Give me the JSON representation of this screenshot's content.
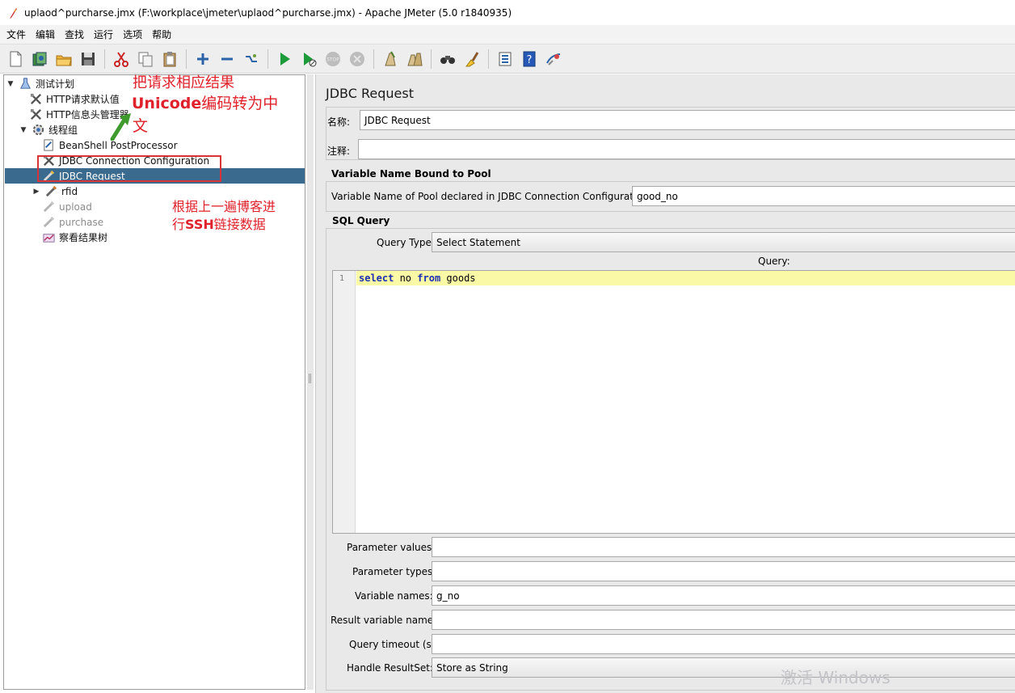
{
  "window": {
    "title": "uplaod^purcharse.jmx (F:\\workplace\\jmeter\\uplaod^purcharse.jmx) - Apache JMeter (5.0 r1840935)"
  },
  "menu": [
    "文件",
    "编辑",
    "查找",
    "运行",
    "选项",
    "帮助"
  ],
  "toolbar": {
    "icons": [
      "new-icon",
      "templates-icon",
      "open-icon",
      "save-icon",
      "cut-icon",
      "copy-icon",
      "paste-icon",
      "expand-icon",
      "collapse-icon",
      "toggle-icon",
      "start-icon",
      "start-no-pause-icon",
      "stop-icon",
      "shutdown-icon",
      "clear-icon",
      "clear-all-icon",
      "search-icon",
      "reset-search-icon",
      "function-helper-icon",
      "help-icon",
      "remote-icon"
    ]
  },
  "tree": [
    {
      "label": "测试计划",
      "icon": "test-plan-icon",
      "expanded": true
    },
    {
      "label": "HTTP请求默认值",
      "icon": "config-icon"
    },
    {
      "label": "HTTP信息头管理器",
      "icon": "config-icon"
    },
    {
      "label": "线程组",
      "icon": "thread-group-icon",
      "expanded": true
    },
    {
      "label": "BeanShell PostProcessor",
      "icon": "postprocessor-icon"
    },
    {
      "label": "JDBC Connection Configuration",
      "icon": "config-icon"
    },
    {
      "label": "JDBC Request",
      "icon": "sampler-icon",
      "selected": true
    },
    {
      "label": "rfid",
      "icon": "sampler-icon",
      "collapsed": true
    },
    {
      "label": "upload",
      "icon": "sampler-icon",
      "disabled": true
    },
    {
      "label": "purchase",
      "icon": "sampler-icon",
      "disabled": true
    },
    {
      "label": "察看结果树",
      "icon": "listener-icon"
    }
  ],
  "annotations": {
    "top_line1": "把请求相应结果",
    "top_line2_bold": "Unicode",
    "top_line2_rest": "编码转为中",
    "top_line3": "文",
    "mid_line1": "根据上一遍博客进",
    "mid_line2_pre": "行",
    "mid_line2_bold": "SSH",
    "mid_line2_rest": "链接数据"
  },
  "panel": {
    "title": "JDBC Request",
    "name_label": "名称:",
    "name_value": "JDBC Request",
    "comment_label": "注释:",
    "comment_value": "",
    "pool_section_title": "Variable Name Bound to Pool",
    "pool_label": "Variable Name of Pool declared in JDBC Connection Configuration:",
    "pool_value": "good_no",
    "sql_section_title": "SQL Query",
    "query_type_label": "Query Type:",
    "query_type_value": "Select Statement",
    "query_label": "Query:",
    "query_line_no": "1",
    "query_kw1": "select",
    "query_mid": " no ",
    "query_kw2": "from",
    "query_end": " goods",
    "parameter_values_label": "Parameter values:",
    "parameter_values_value": "",
    "parameter_types_label": "Parameter types:",
    "parameter_types_value": "",
    "variable_names_label": "Variable names:",
    "variable_names_value": "g_no",
    "result_variable_label": "Result variable name:",
    "result_variable_value": "",
    "query_timeout_label": "Query timeout (s):",
    "query_timeout_value": "",
    "handle_resultset_label": "Handle ResultSet:",
    "handle_resultset_value": "Store as String"
  },
  "watermark": "激活 Windows"
}
